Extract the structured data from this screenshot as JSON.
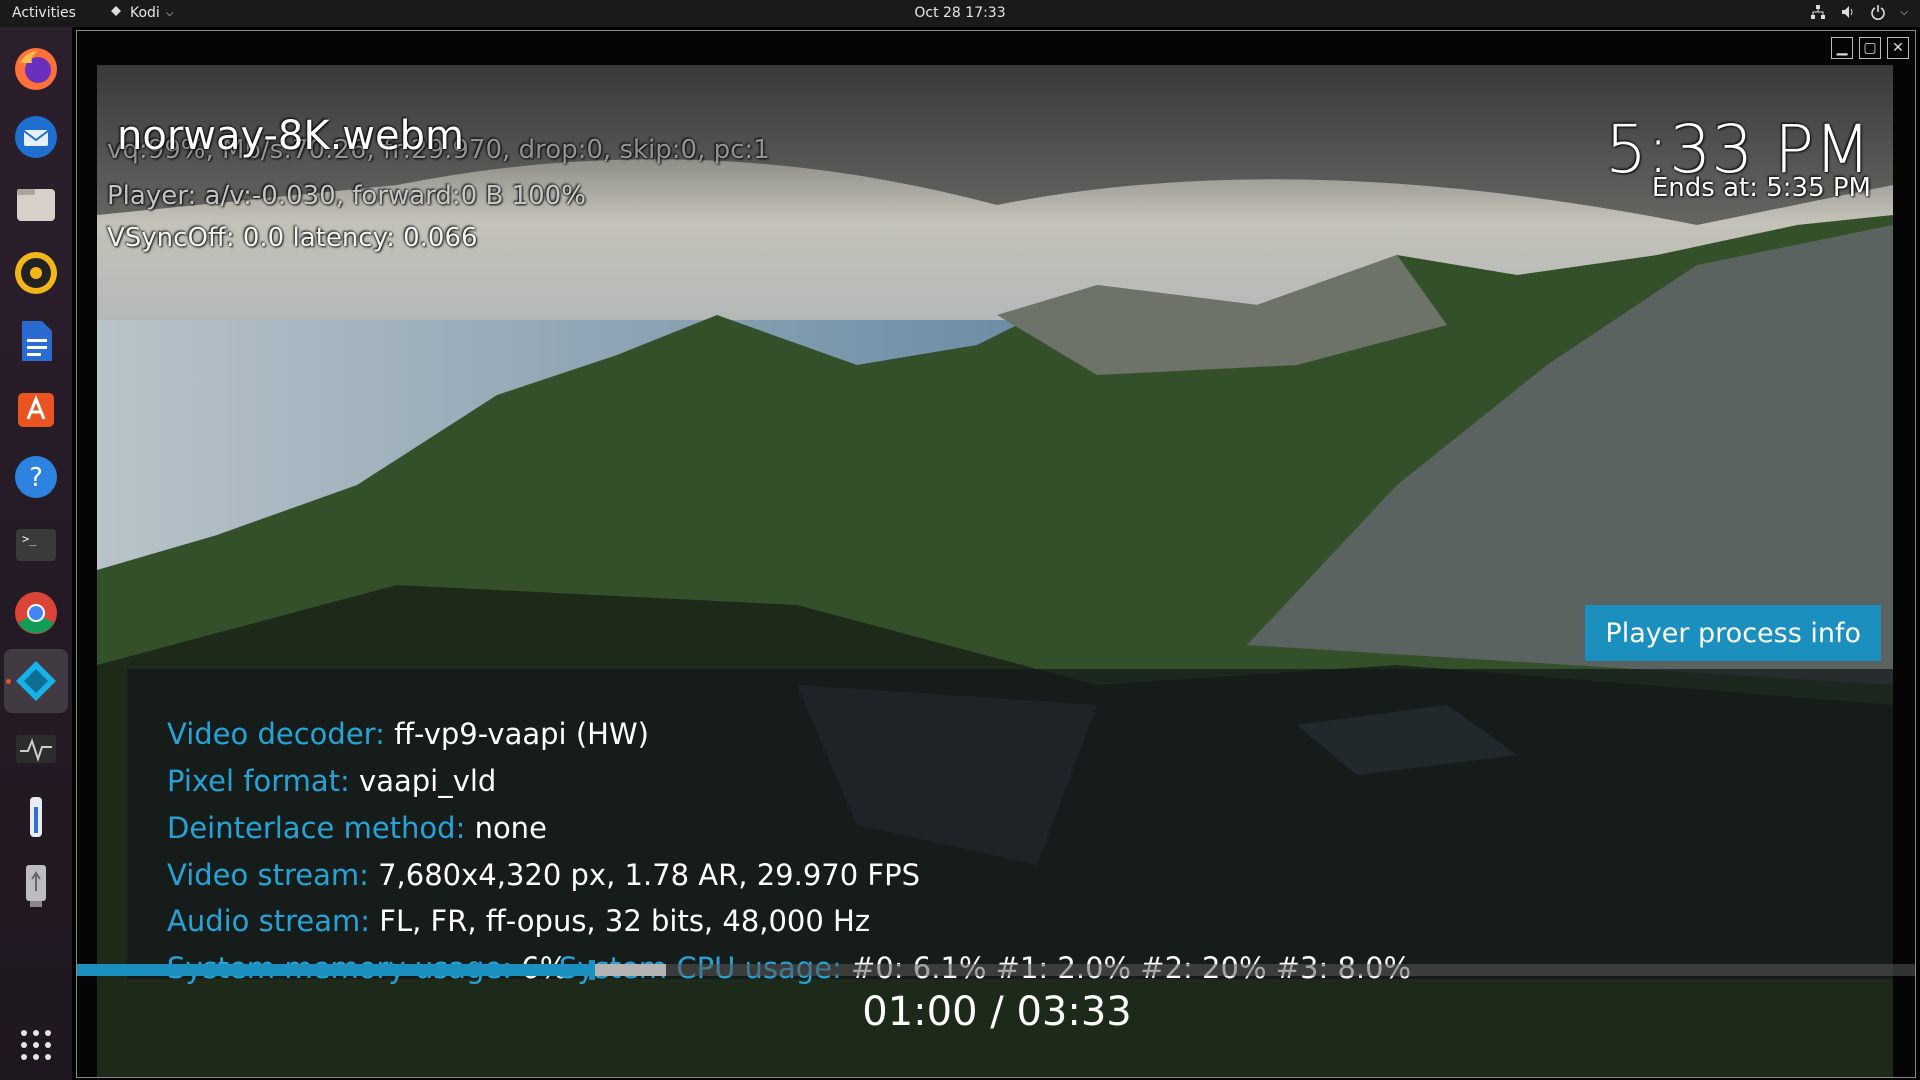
{
  "topbar": {
    "activities": "Activities",
    "app_name": "Kodi",
    "clock": "Oct 28  17:33",
    "status_icons": [
      "network-icon",
      "volume-icon",
      "power-icon",
      "chevron-down-icon"
    ]
  },
  "dock": {
    "items": [
      "firefox",
      "thunderbird",
      "files",
      "rhythmbox",
      "libreoffice-writer",
      "ubuntu-software",
      "help",
      "terminal",
      "chrome",
      "kodi",
      "system-monitor",
      "thermometer",
      "usb-drive"
    ],
    "apps_grid": "show-applications"
  },
  "player": {
    "filename": "norway-8K.webm",
    "debug_line1": "vq:99%, Mb/s:70.26, fr:29.970, drop:0, skip:0, pc:1",
    "debug_line2": "Player: a/v:-0.030,  forward:0 B 100%",
    "debug_line3": "VSyncOff: 0.0 latency: 0.066",
    "clock": "5:33 PM",
    "ends_at": "Ends at: 5:35 PM",
    "info_button": "Player process info",
    "info": {
      "video_decoder_label": "Video decoder:",
      "video_decoder": "ff-vp9-vaapi (HW)",
      "pixel_format_label": "Pixel format:",
      "pixel_format": "vaapi_vld",
      "deinterlace_label": "Deinterlace method:",
      "deinterlace": "none",
      "video_stream_label": "Video stream:",
      "video_stream": "7,680x4,320 px, 1.78 AR, 29.970 FPS",
      "audio_stream_label": "Audio stream:",
      "audio_stream": "FL, FR, ff-opus, 32 bits, 48,000 Hz",
      "memory_label": "System memory usage:",
      "memory": "6%",
      "cpu_label": "System CPU usage:",
      "cpu": "#0: 6.1% #1: 2.0% #2:  20% #3: 8.0%"
    },
    "progress": {
      "played_fraction": 0.28,
      "cache_fraction": 0.32
    },
    "time": "01:00 / 03:33"
  },
  "colors": {
    "accent": "#1b8fbd",
    "label": "#26a3d6",
    "dock_bg": "#2b1f2c"
  }
}
